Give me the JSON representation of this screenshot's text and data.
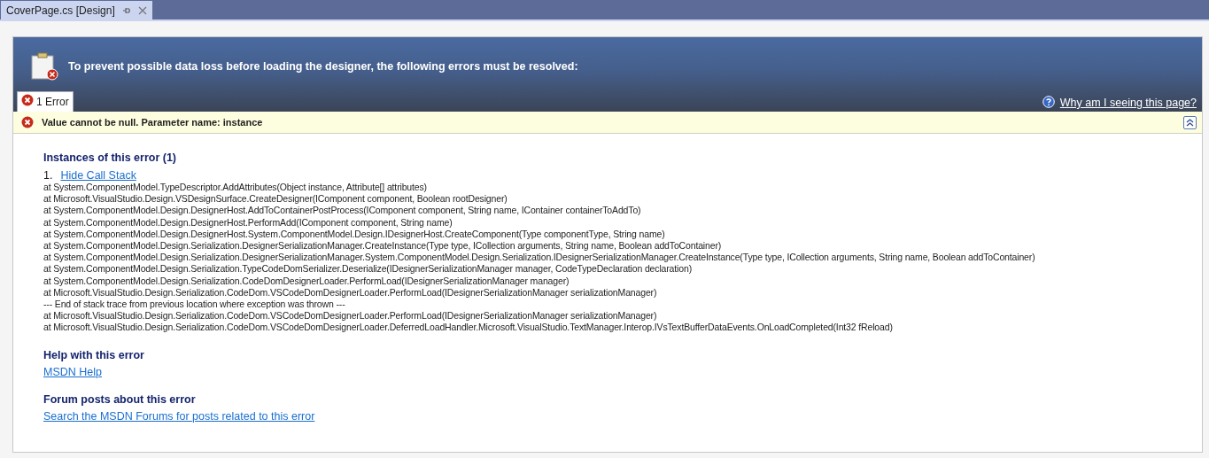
{
  "document_tab": {
    "title": "CoverPage.cs [Design]",
    "selected": true
  },
  "header": {
    "message": "To prevent possible data loss before loading the designer, the following errors must be resolved:",
    "help_link": "Why am I seeing this page?"
  },
  "error_tabs": [
    {
      "label": "1 Error",
      "selected": true
    }
  ],
  "error": {
    "message": "Value cannot be null. Parameter name: instance",
    "expanded": true,
    "instances_heading": "Instances of this error (1)",
    "instances": [
      {
        "number": "1.",
        "toggle_link": "Hide Call Stack",
        "call_stack": [
          "at System.ComponentModel.TypeDescriptor.AddAttributes(Object instance, Attribute[] attributes)",
          "at Microsoft.VisualStudio.Design.VSDesignSurface.CreateDesigner(IComponent component, Boolean rootDesigner)",
          "at System.ComponentModel.Design.DesignerHost.AddToContainerPostProcess(IComponent component, String name, IContainer containerToAddTo)",
          "at System.ComponentModel.Design.DesignerHost.PerformAdd(IComponent component, String name)",
          "at System.ComponentModel.Design.DesignerHost.System.ComponentModel.Design.IDesignerHost.CreateComponent(Type componentType, String name)",
          "at System.ComponentModel.Design.Serialization.DesignerSerializationManager.CreateInstance(Type type, ICollection arguments, String name, Boolean addToContainer)",
          "at System.ComponentModel.Design.Serialization.DesignerSerializationManager.System.ComponentModel.Design.Serialization.IDesignerSerializationManager.CreateInstance(Type type, ICollection arguments, String name, Boolean addToContainer)",
          "at System.ComponentModel.Design.Serialization.TypeCodeDomSerializer.Deserialize(IDesignerSerializationManager manager, CodeTypeDeclaration declaration)",
          "at System.ComponentModel.Design.Serialization.CodeDomDesignerLoader.PerformLoad(IDesignerSerializationManager manager)",
          "at Microsoft.VisualStudio.Design.Serialization.CodeDom.VSCodeDomDesignerLoader.PerformLoad(IDesignerSerializationManager serializationManager)",
          "--- End of stack trace from previous location where exception was thrown ---",
          "at Microsoft.VisualStudio.Design.Serialization.CodeDom.VSCodeDomDesignerLoader.PerformLoad(IDesignerSerializationManager serializationManager)",
          "at Microsoft.VisualStudio.Design.Serialization.CodeDom.VSCodeDomDesignerLoader.DeferredLoadHandler.Microsoft.VisualStudio.TextManager.Interop.IVsTextBufferDataEvents.OnLoadCompleted(Int32 fReload)"
        ]
      }
    ],
    "help_heading": "Help with this error",
    "help_link": "MSDN Help",
    "forum_heading": "Forum posts about this error",
    "forum_link": "Search the MSDN Forums for posts related to this error"
  }
}
